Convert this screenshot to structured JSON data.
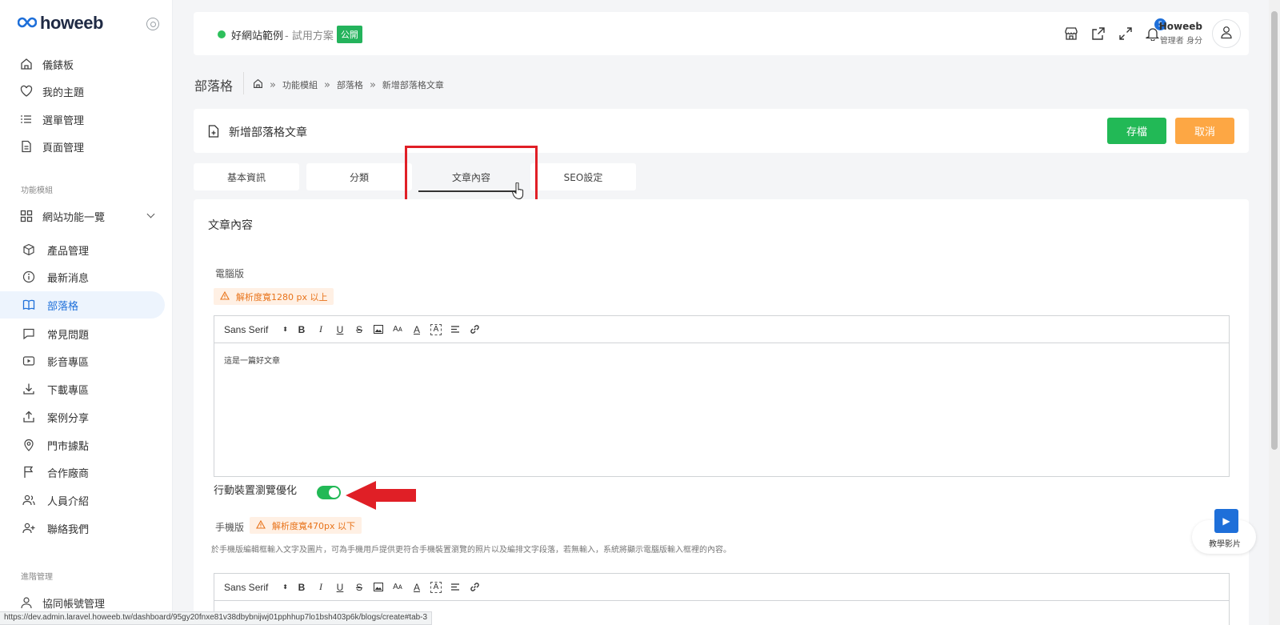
{
  "brand": {
    "logo_text": "howeeb"
  },
  "sidebar": {
    "top_items": [
      {
        "label": "儀錶板",
        "icon": "home-icon"
      },
      {
        "label": "我的主題",
        "icon": "heart-icon"
      },
      {
        "label": "選單管理",
        "icon": "list-icon"
      },
      {
        "label": "頁面管理",
        "icon": "document-icon"
      }
    ],
    "section_modules": "功能模組",
    "modules_group": "網站功能一覽",
    "module_items": [
      {
        "label": "產品管理",
        "icon": "cube-icon"
      },
      {
        "label": "最新消息",
        "icon": "info-icon"
      },
      {
        "label": "部落格",
        "icon": "book-icon"
      },
      {
        "label": "常見問題",
        "icon": "chat-icon"
      },
      {
        "label": "影音專區",
        "icon": "video-icon"
      },
      {
        "label": "下載專區",
        "icon": "download-icon"
      },
      {
        "label": "案例分享",
        "icon": "share-icon"
      },
      {
        "label": "門市據點",
        "icon": "map-pin-icon"
      },
      {
        "label": "合作廠商",
        "icon": "flag-icon"
      },
      {
        "label": "人員介紹",
        "icon": "users-icon"
      },
      {
        "label": "聯絡我們",
        "icon": "user-plus-icon"
      }
    ],
    "section_admin": "進階管理",
    "admin_items": [
      {
        "label": "協同帳號管理",
        "icon": "user-icon"
      }
    ],
    "active_item": "部落格"
  },
  "header": {
    "site_name": "好網站範例",
    "plan": " - 試用方案",
    "public_badge": "公開",
    "notification_count": "5",
    "user_name": "Howeeb",
    "user_role": "管理者 身分"
  },
  "breadcrumb": {
    "page_title": "部落格",
    "items": [
      "功能模組",
      "部落格",
      "新增部落格文章"
    ]
  },
  "form": {
    "title": "新增部落格文章",
    "save_label": "存檔",
    "cancel_label": "取消"
  },
  "tabs": [
    {
      "label": "基本資訊"
    },
    {
      "label": "分類"
    },
    {
      "label": "文章內容"
    },
    {
      "label": "SEO設定"
    }
  ],
  "content": {
    "section_title": "文章內容",
    "desktop_label": "電腦版",
    "desktop_warning": "解析度寬1280 px 以上",
    "editor_font": "Sans Serif",
    "desktop_body": "這是一篇好文章",
    "mobile_toggle_label": "行動裝置瀏覽優化",
    "mobile_toggle_on": true,
    "mobile_label": "手機版",
    "mobile_warning": "解析度寬470px 以下",
    "mobile_hint": "於手機版編輯框輸入文字及圖片，可為手機用戶提供更符合手機裝置瀏覽的照片以及編排文字段落，若無輸入，系統將顯示電腦版輸入框裡的內容。"
  },
  "tutorial": {
    "label": "教學影片"
  },
  "status_bar_url": "https://dev.admin.laravel.howeeb.tw/dashboard/95gy20fnxe81v38dbybnijwj01pphhup7lo1bsh403p6k/blogs/create#tab-3",
  "colors": {
    "accent": "#1e6fd9",
    "save": "#22b956",
    "cancel": "#fda744",
    "warning_text": "#e8731a",
    "highlight_red": "#e01f26"
  }
}
